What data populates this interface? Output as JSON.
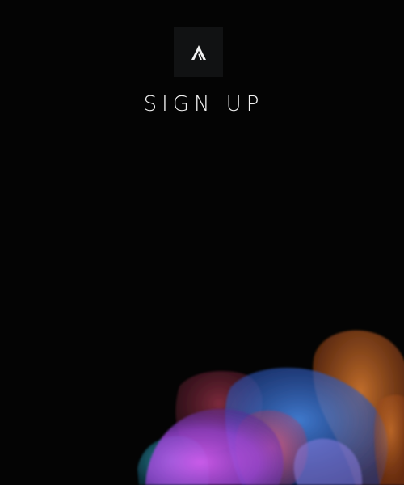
{
  "logo": {
    "icon": "triangle-a-logo-icon"
  },
  "title": "SIGN UP",
  "theme": {
    "background": "#040404",
    "logo_background": "#111213",
    "text": "#f2f2f2",
    "blob_colors": [
      "#c24fe0",
      "#e0507a",
      "#3d6fd8",
      "#2ab3c7",
      "#e07a2a"
    ]
  }
}
